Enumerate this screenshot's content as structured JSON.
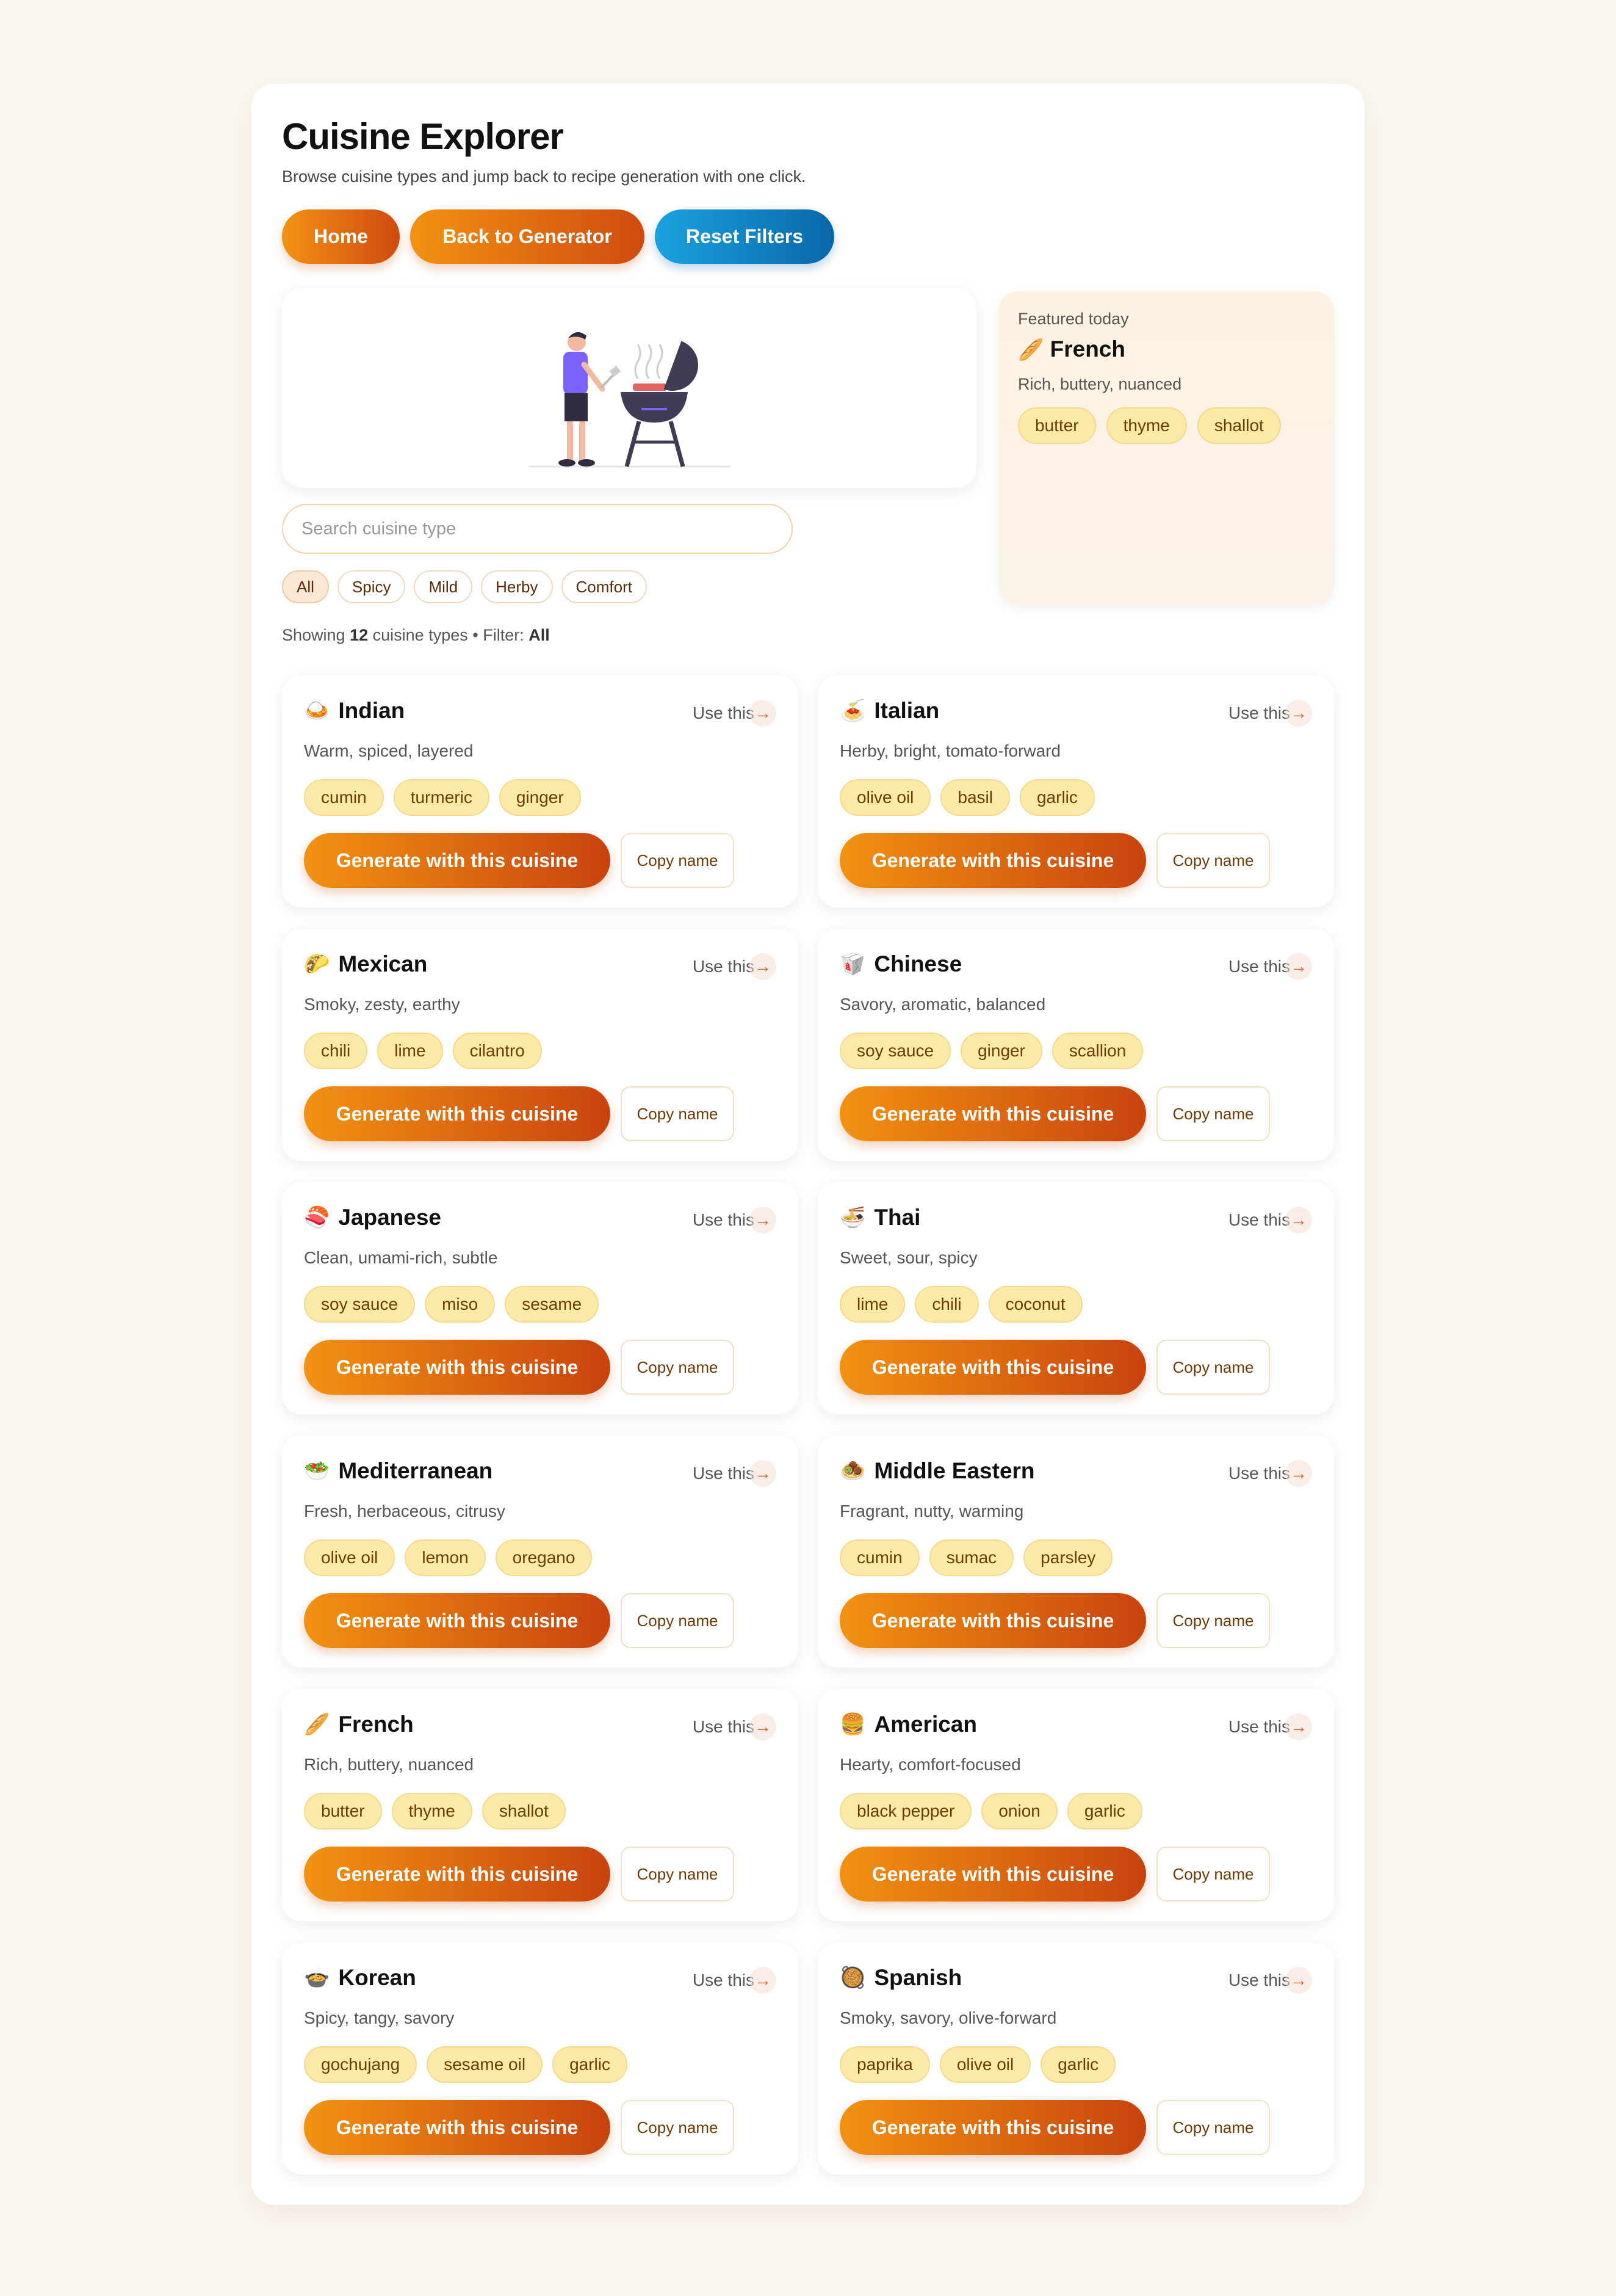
{
  "app": {
    "title": "Cuisine Explorer",
    "subtitle": "Browse cuisine types and jump back to recipe generation with one click."
  },
  "nav": {
    "home": "Home",
    "back": "Back to Generator",
    "reset": "Reset Filters"
  },
  "featured": {
    "label": "Featured today",
    "emoji": "🥖",
    "name": "French",
    "desc": "Rich, buttery, nuanced",
    "tags": [
      "butter",
      "thyme",
      "shallot"
    ]
  },
  "search": {
    "placeholder": "Search cuisine type",
    "value": ""
  },
  "filters": [
    "All",
    "Spicy",
    "Mild",
    "Herby",
    "Comfort"
  ],
  "active_filter": "All",
  "status": {
    "prefix": "Showing",
    "count": "12",
    "unit": "cuisine types",
    "sep": "•",
    "filter_label": "Filter:",
    "filter_value": "All"
  },
  "card_labels": {
    "use": "Use this",
    "generate": "Generate with this cuisine",
    "copy": "Copy name"
  },
  "cuisines": [
    {
      "emoji": "🍛",
      "name": "Indian",
      "desc": "Warm, spiced, layered",
      "tags": [
        "cumin",
        "turmeric",
        "ginger"
      ]
    },
    {
      "emoji": "🍝",
      "name": "Italian",
      "desc": "Herby, bright, tomato-forward",
      "tags": [
        "olive oil",
        "basil",
        "garlic"
      ]
    },
    {
      "emoji": "🌮",
      "name": "Mexican",
      "desc": "Smoky, zesty, earthy",
      "tags": [
        "chili",
        "lime",
        "cilantro"
      ]
    },
    {
      "emoji": "🥡",
      "name": "Chinese",
      "desc": "Savory, aromatic, balanced",
      "tags": [
        "soy sauce",
        "ginger",
        "scallion"
      ]
    },
    {
      "emoji": "🍣",
      "name": "Japanese",
      "desc": "Clean, umami-rich, subtle",
      "tags": [
        "soy sauce",
        "miso",
        "sesame"
      ]
    },
    {
      "emoji": "🍜",
      "name": "Thai",
      "desc": "Sweet, sour, spicy",
      "tags": [
        "lime",
        "chili",
        "coconut"
      ]
    },
    {
      "emoji": "🥗",
      "name": "Mediterranean",
      "desc": "Fresh, herbaceous, citrusy",
      "tags": [
        "olive oil",
        "lemon",
        "oregano"
      ]
    },
    {
      "emoji": "🧆",
      "name": "Middle Eastern",
      "desc": "Fragrant, nutty, warming",
      "tags": [
        "cumin",
        "sumac",
        "parsley"
      ]
    },
    {
      "emoji": "🥖",
      "name": "French",
      "desc": "Rich, buttery, nuanced",
      "tags": [
        "butter",
        "thyme",
        "shallot"
      ]
    },
    {
      "emoji": "🍔",
      "name": "American",
      "desc": "Hearty, comfort-focused",
      "tags": [
        "black pepper",
        "onion",
        "garlic"
      ]
    },
    {
      "emoji": "🍲",
      "name": "Korean",
      "desc": "Spicy, tangy, savory",
      "tags": [
        "gochujang",
        "sesame oil",
        "garlic"
      ]
    },
    {
      "emoji": "🥘",
      "name": "Spanish",
      "desc": "Smoky, savory, olive-forward",
      "tags": [
        "paprika",
        "olive oil",
        "garlic"
      ]
    }
  ],
  "colors": {
    "accent": "#f29211",
    "accent_dark": "#c8430f",
    "blue": "#1aa2e0",
    "tag_bg": "#fdeaa9"
  }
}
